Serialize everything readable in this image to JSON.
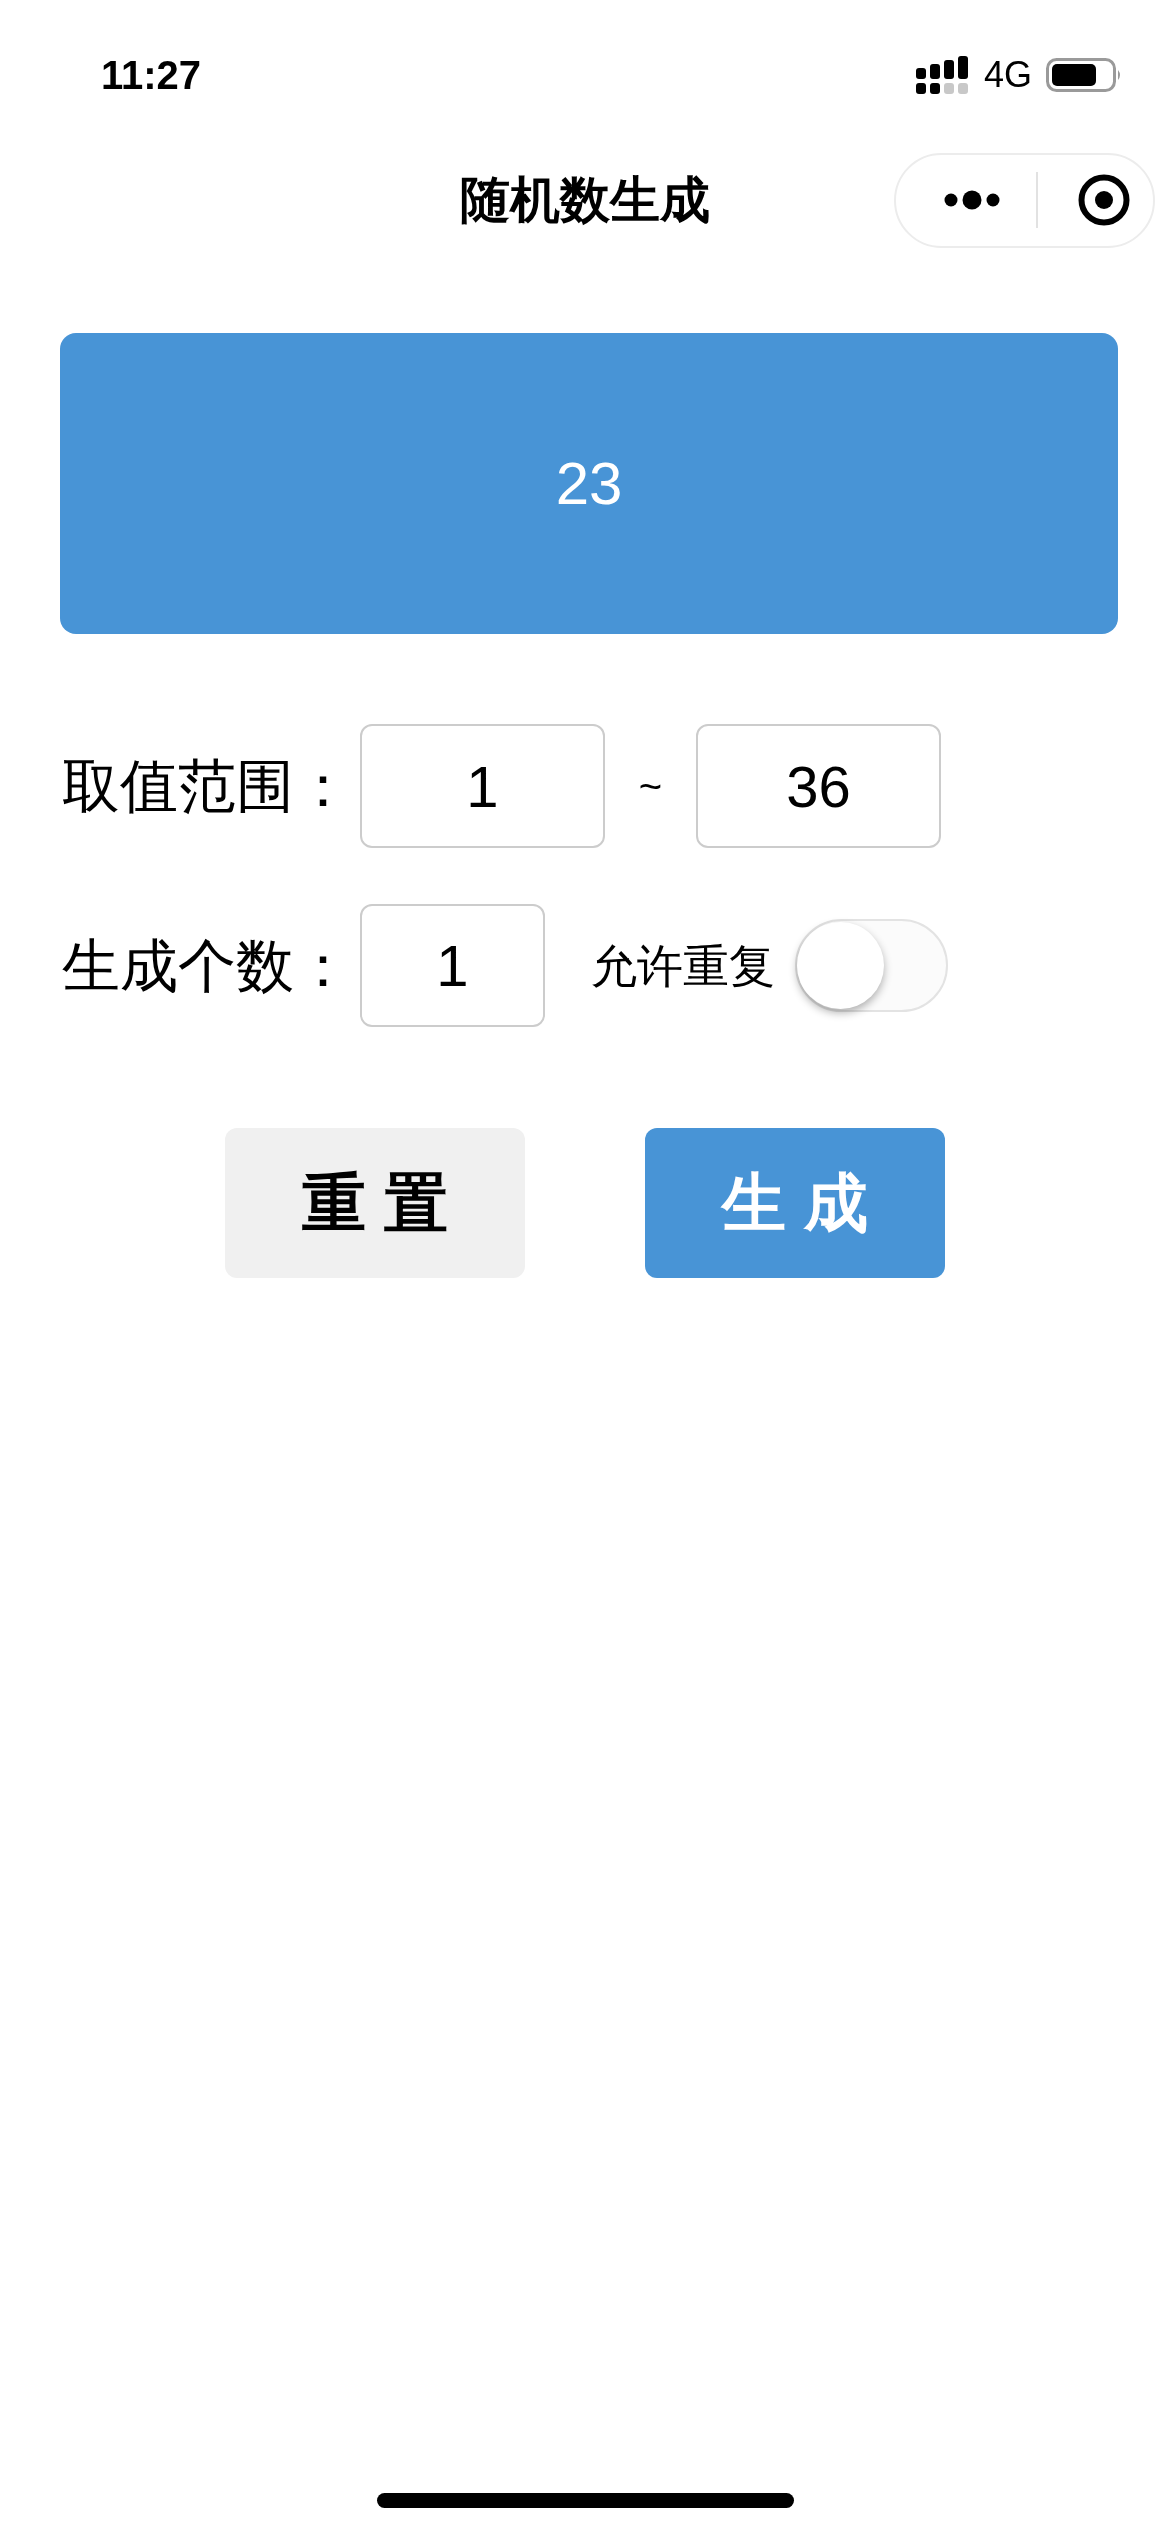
{
  "status_bar": {
    "time": "11:27",
    "network": "4G"
  },
  "nav_bar": {
    "title": "随机数生成"
  },
  "result": {
    "value": "23"
  },
  "range": {
    "label": "取值范围：",
    "min": "1",
    "separator": "~",
    "max": "36"
  },
  "count": {
    "label": "生成个数：",
    "value": "1"
  },
  "allow_repeat": {
    "label": "允许重复",
    "on": false
  },
  "buttons": [
    {
      "kind": "secondary",
      "label": "重 置"
    },
    {
      "kind": "primary",
      "label": "生 成"
    }
  ]
}
